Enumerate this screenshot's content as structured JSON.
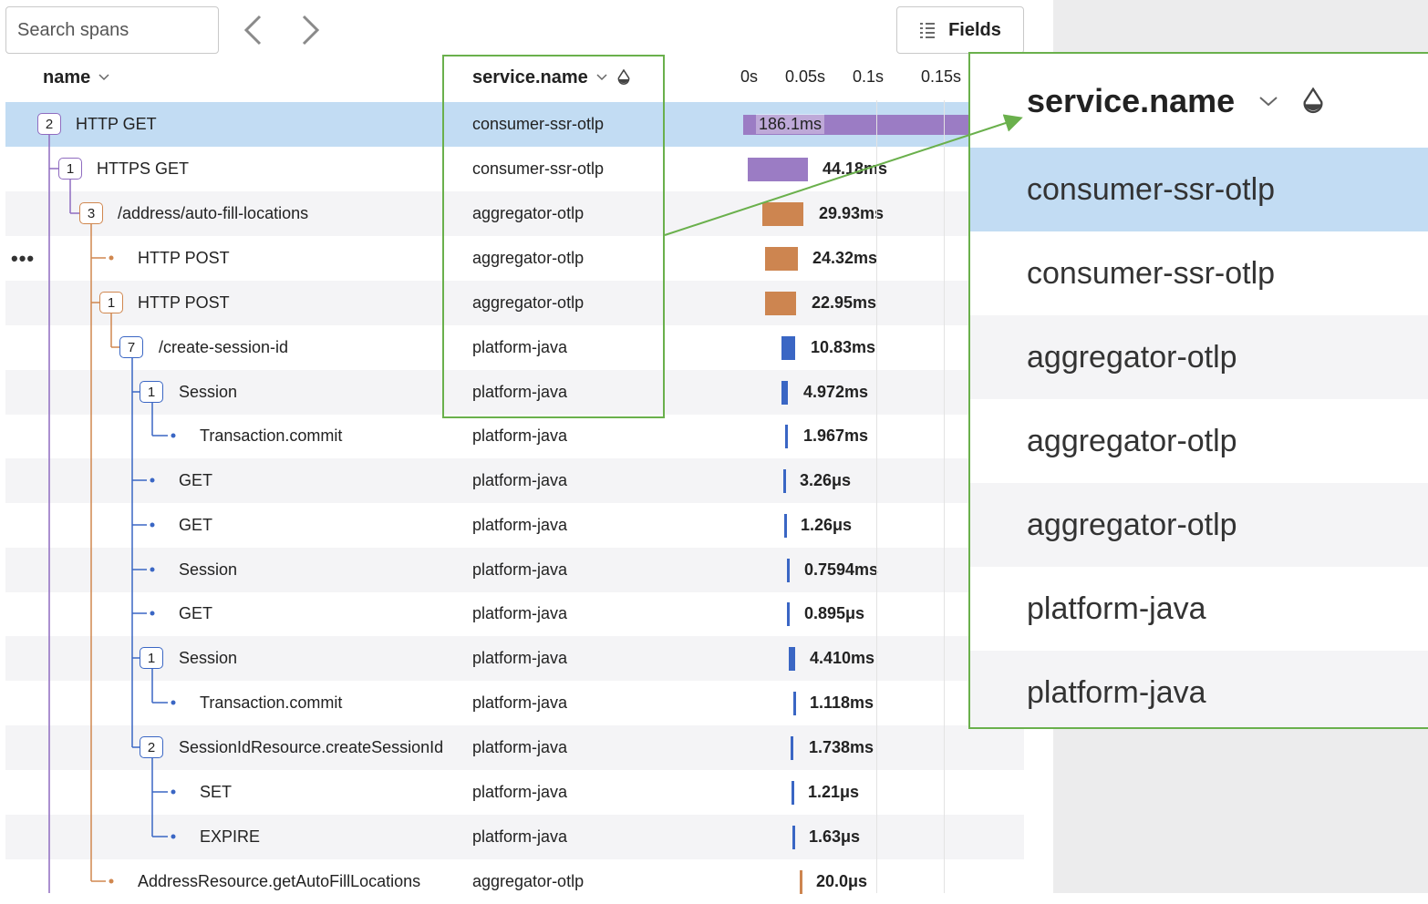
{
  "toolbar": {
    "search_placeholder": "Search spans",
    "fields_label": "Fields",
    "back_icon": "chevron-left-icon",
    "forward_icon": "chevron-right-icon"
  },
  "columns": {
    "name": "name",
    "service": "service.name"
  },
  "timeline_ticks": [
    "0s",
    "0.05s",
    "0.1s",
    "0.15s"
  ],
  "spans": [
    {
      "name": "HTTP GET",
      "service": "consumer-ssr-otlp",
      "duration": "186.1ms",
      "children": "2",
      "selected": true
    },
    {
      "name": "HTTPS GET",
      "service": "consumer-ssr-otlp",
      "duration": "44.18ms",
      "children": "1"
    },
    {
      "name": "/address/auto-fill-locations",
      "service": "aggregator-otlp",
      "duration": "29.93ms",
      "children": "3"
    },
    {
      "name": "HTTP POST",
      "service": "aggregator-otlp",
      "duration": "24.32ms"
    },
    {
      "name": "HTTP POST",
      "service": "aggregator-otlp",
      "duration": "22.95ms",
      "children": "1"
    },
    {
      "name": "/create-session-id",
      "service": "platform-java",
      "duration": "10.83ms",
      "children": "7"
    },
    {
      "name": "Session",
      "service": "platform-java",
      "duration": "4.972ms",
      "children": "1"
    },
    {
      "name": "Transaction.commit",
      "service": "platform-java",
      "duration": "1.967ms"
    },
    {
      "name": "GET",
      "service": "platform-java",
      "duration": "3.26μs"
    },
    {
      "name": "GET",
      "service": "platform-java",
      "duration": "1.26μs"
    },
    {
      "name": "Session",
      "service": "platform-java",
      "duration": "0.7594ms"
    },
    {
      "name": "GET",
      "service": "platform-java",
      "duration": "0.895μs"
    },
    {
      "name": "Session",
      "service": "platform-java",
      "duration": "4.410ms",
      "children": "1"
    },
    {
      "name": "Transaction.commit",
      "service": "platform-java",
      "duration": "1.118ms"
    },
    {
      "name": "SessionIdResource.createSessionId",
      "service": "platform-java",
      "duration": "1.738ms",
      "children": "2"
    },
    {
      "name": "SET",
      "service": "platform-java",
      "duration": "1.21μs"
    },
    {
      "name": "EXPIRE",
      "service": "platform-java",
      "duration": "1.63μs"
    },
    {
      "name": "AddressResource.getAutoFillLocations",
      "service": "aggregator-otlp",
      "duration": "20.0μs"
    }
  ],
  "zoom": {
    "header": "service.name",
    "values": [
      "consumer-ssr-otlp",
      "consumer-ssr-otlp",
      "aggregator-otlp",
      "aggregator-otlp",
      "aggregator-otlp",
      "platform-java",
      "platform-java"
    ]
  },
  "colors": {
    "consumer-ssr-otlp": "#9b7cc4",
    "aggregator-otlp": "#cd8550",
    "platform-java": "#3a66c4",
    "selection": "#c2dcf3",
    "highlight": "#6ab04c"
  }
}
